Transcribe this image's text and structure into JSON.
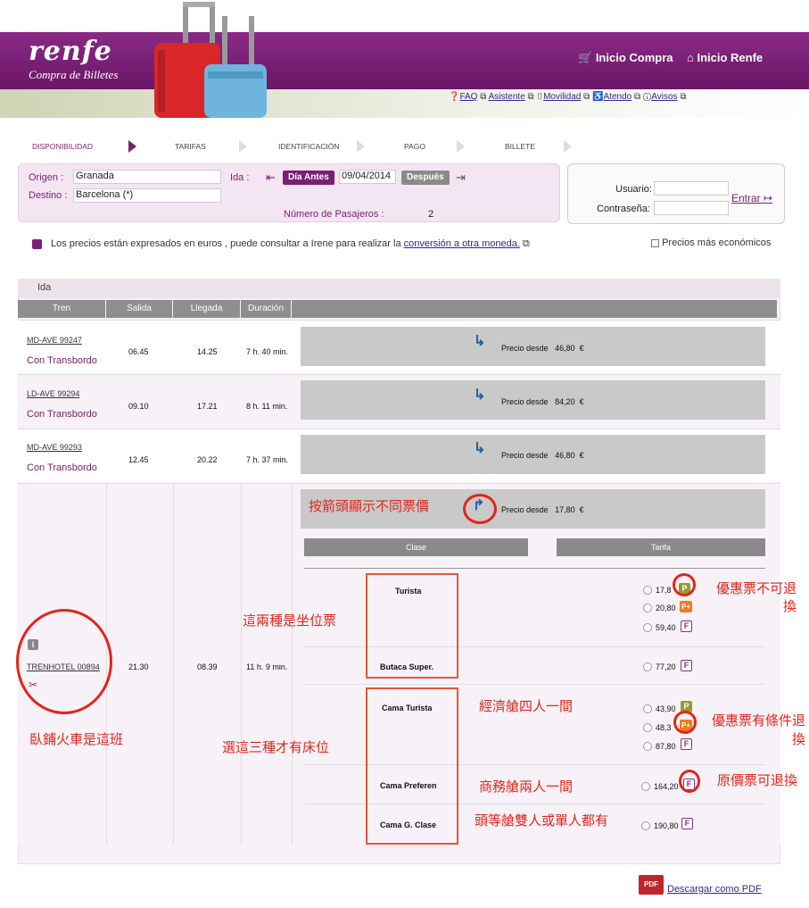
{
  "header": {
    "logo": "renfe",
    "subtitle": "Compra de Billetes",
    "inicio_compra": "Inicio Compra",
    "inicio_renfe": "Inicio Renfe",
    "help_links": [
      "FAQ",
      "Asistente",
      "Movilidad",
      "Atendo",
      "Avisos"
    ]
  },
  "steps": [
    "DISPONIBILIDAD",
    "TARIFAS",
    "IDENTIFICACIÓN",
    "PAGO",
    "BILLETE"
  ],
  "search": {
    "origen_label": "Origen :",
    "origen": "Granada",
    "destino_label": "Destino :",
    "destino": "Barcelona (*)",
    "ida_label": "Ida :",
    "dia_antes": "Día Antes",
    "fecha": "09/04/2014",
    "despues": "Después",
    "pasajeros_label": "Número de Pasajeros :",
    "pasajeros": "2"
  },
  "login": {
    "usuario_label": "Usuario:",
    "contrasena_label": "Contraseña:",
    "entrar": "Entrar"
  },
  "notice": {
    "text": "Los precios están expresados en euros , puede consultar a Irene para realizar la",
    "link": "conversión a otra moneda.",
    "cheapest": "Precios más económicos"
  },
  "table": {
    "section": "Ida",
    "headers": [
      "Tren",
      "Salida",
      "Llegada",
      "Duración"
    ],
    "rows": [
      {
        "train": "MD-AVE 99247",
        "note": "Con Transbordo",
        "salida": "06.45",
        "llegada": "14.25",
        "duracion": "7 h. 40 min.",
        "precio_label": "Precio desde",
        "precio": "46,80",
        "currency": "€"
      },
      {
        "train": "LD-AVE 99294",
        "note": "Con Transbordo",
        "salida": "09.10",
        "llegada": "17.21",
        "duracion": "8 h. 11 min.",
        "precio_label": "Precio desde",
        "precio": "84,20",
        "currency": "€"
      },
      {
        "train": "MD-AVE 99293",
        "note": "Con Transbordo",
        "salida": "12.45",
        "llegada": "20.22",
        "duracion": "7 h. 37 min.",
        "precio_label": "Precio desde",
        "precio": "46,80",
        "currency": "€"
      }
    ],
    "expanded": {
      "train": "TRENHOTEL 00894",
      "salida": "21.30",
      "llegada": "08.39",
      "duracion": "11 h. 9 min.",
      "precio_label": "Precio desde",
      "precio": "17,80",
      "currency": "€",
      "clase_header": "Clase",
      "tarifa_header": "Tarifa",
      "classes": [
        {
          "name": "Turista",
          "fares": [
            {
              "price": "17,8",
              "badge": "P"
            },
            {
              "price": "20,80",
              "badge": "P+"
            },
            {
              "price": "59,40",
              "badge": "F"
            }
          ]
        },
        {
          "name": "Butaca Super.",
          "fares": [
            {
              "price": "77,20",
              "badge": "F"
            }
          ]
        },
        {
          "name": "Cama Turista",
          "fares": [
            {
              "price": "43,90",
              "badge": "P"
            },
            {
              "price": "48,3",
              "badge": "P+"
            },
            {
              "price": "87,80",
              "badge": "F"
            }
          ]
        },
        {
          "name": "Cama Preferen",
          "fares": [
            {
              "price": "164,20",
              "badge": "F"
            }
          ]
        },
        {
          "name": "Cama G. Clase",
          "fares": [
            {
              "price": "190,80",
              "badge": "F"
            }
          ]
        }
      ]
    }
  },
  "annotations": {
    "arrow_note": "按箭頭顯示不同票價",
    "seat_note": "這兩種是坐位票",
    "sleeper_train": "臥鋪火車是這班",
    "bed_note": "選這三種才有床位",
    "economy_four": "經濟艙四人一間",
    "business_two": "商務艙兩人一間",
    "first_class": "頭等艙雙人或單人都有",
    "promo_no_refund": "優惠票不可退換",
    "promo_conditional": "優惠票有條件退換",
    "full_refund": "原價票可退換"
  },
  "footer": {
    "pdf": "Descargar como PDF"
  },
  "colors": {
    "brand": "#7a1f74",
    "annotation": "#e0261b"
  }
}
